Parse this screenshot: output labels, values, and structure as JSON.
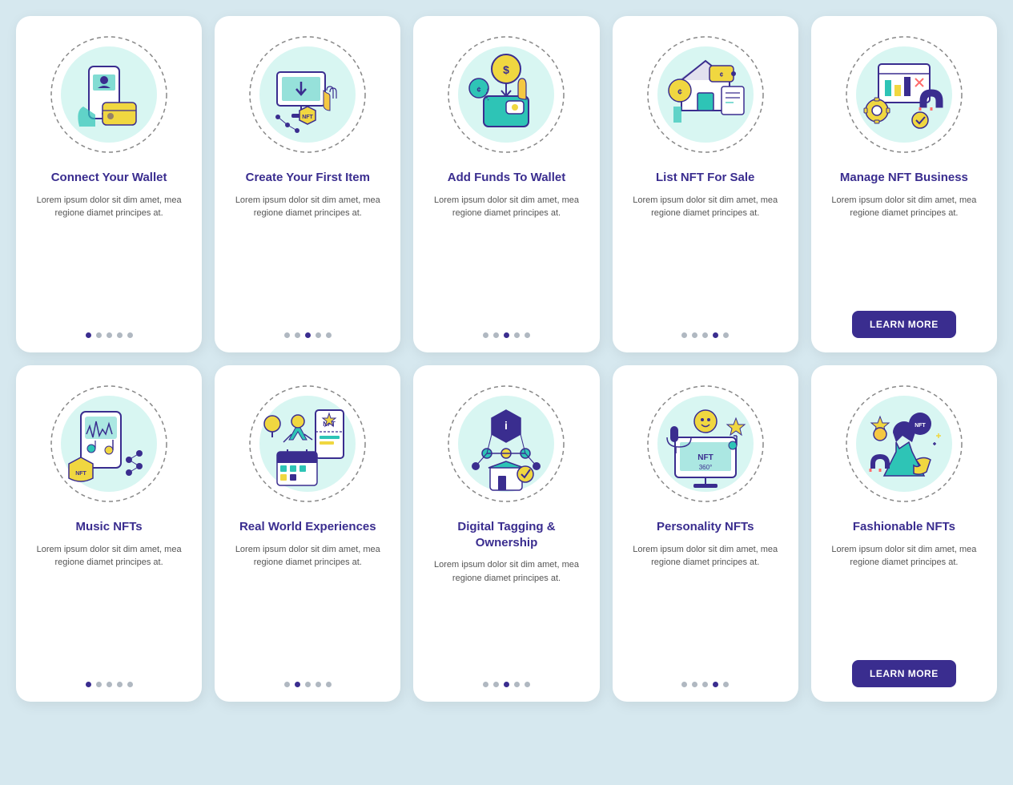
{
  "cards": [
    {
      "id": "connect-wallet",
      "title": "Connect Your Wallet",
      "body": "Lorem ipsum dolor sit dim amet, mea regione diamet principes at.",
      "dots": [
        true,
        false,
        false,
        false,
        false
      ],
      "hasButton": false,
      "buttonLabel": ""
    },
    {
      "id": "create-first-item",
      "title": "Create Your First Item",
      "body": "Lorem ipsum dolor sit dim amet, mea regione diamet principes at.",
      "dots": [
        false,
        false,
        true,
        false,
        false
      ],
      "hasButton": false,
      "buttonLabel": ""
    },
    {
      "id": "add-funds",
      "title": "Add Funds To Wallet",
      "body": "Lorem ipsum dolor sit dim amet, mea regione diamet principes at.",
      "dots": [
        false,
        false,
        true,
        false,
        false
      ],
      "hasButton": false,
      "buttonLabel": ""
    },
    {
      "id": "list-nft",
      "title": "List NFT For Sale",
      "body": "Lorem ipsum dolor sit dim amet, mea regione diamet principes at.",
      "dots": [
        false,
        false,
        false,
        true,
        false
      ],
      "hasButton": false,
      "buttonLabel": ""
    },
    {
      "id": "manage-nft",
      "title": "Manage NFT Business",
      "body": "Lorem ipsum dolor sit dim amet, mea regione diamet principes at.",
      "dots": [
        false,
        false,
        false,
        false,
        true
      ],
      "hasButton": true,
      "buttonLabel": "LEARN MORE"
    },
    {
      "id": "music-nfts",
      "title": "Music NFTs",
      "body": "Lorem ipsum dolor sit dim amet, mea regione diamet principes at.",
      "dots": [
        true,
        false,
        false,
        false,
        false
      ],
      "hasButton": false,
      "buttonLabel": ""
    },
    {
      "id": "real-world",
      "title": "Real World Experiences",
      "body": "Lorem ipsum dolor sit dim amet, mea regione diamet principes at.",
      "dots": [
        false,
        true,
        false,
        false,
        false
      ],
      "hasButton": false,
      "buttonLabel": ""
    },
    {
      "id": "digital-tagging",
      "title": "Digital Tagging & Ownership",
      "body": "Lorem ipsum dolor sit dim amet, mea regione diamet principes at.",
      "dots": [
        false,
        false,
        true,
        false,
        false
      ],
      "hasButton": false,
      "buttonLabel": ""
    },
    {
      "id": "personality-nfts",
      "title": "Personality NFTs",
      "body": "Lorem ipsum dolor sit dim amet, mea regione diamet principes at.",
      "dots": [
        false,
        false,
        false,
        true,
        false
      ],
      "hasButton": false,
      "buttonLabel": ""
    },
    {
      "id": "fashionable-nfts",
      "title": "Fashionable NFTs",
      "body": "Lorem ipsum dolor sit dim amet, mea regione diamet principes at.",
      "dots": [
        false,
        false,
        false,
        false,
        true
      ],
      "hasButton": true,
      "buttonLabel": "LEARN MORE"
    }
  ]
}
